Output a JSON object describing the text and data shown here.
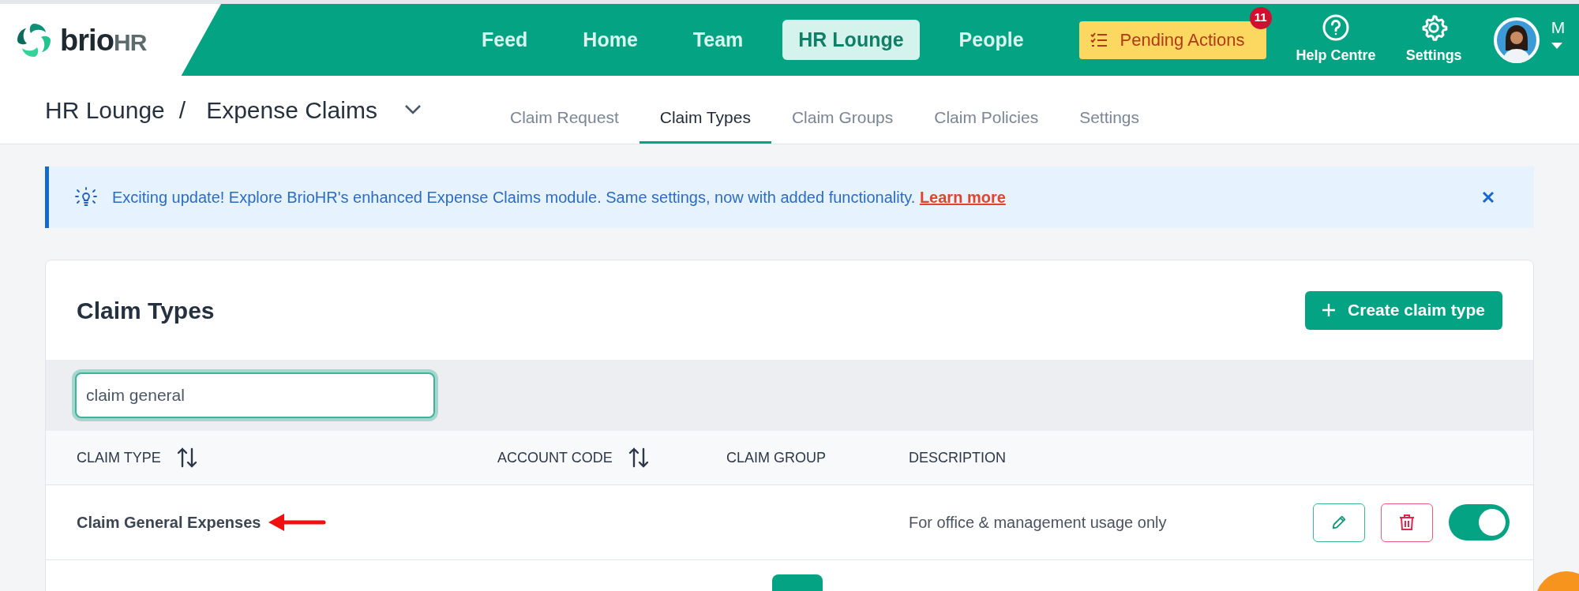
{
  "logo": {
    "primary": "brio",
    "secondary": "HR"
  },
  "nav": [
    {
      "label": "Feed",
      "selected": false
    },
    {
      "label": "Home",
      "selected": false
    },
    {
      "label": "Team",
      "selected": false
    },
    {
      "label": "HR Lounge",
      "selected": true
    },
    {
      "label": "People",
      "selected": false
    }
  ],
  "pending_actions": {
    "label": "Pending Actions",
    "badge": "11"
  },
  "utilities": [
    {
      "kind": "help",
      "label": "Help Centre"
    },
    {
      "kind": "settings",
      "label": "Settings"
    }
  ],
  "user": {
    "initial": "M"
  },
  "breadcrumb": [
    "HR Lounge",
    "/",
    "Expense Claims"
  ],
  "tabs": [
    {
      "label": "Claim Request",
      "selected": false
    },
    {
      "label": "Claim Types",
      "selected": true
    },
    {
      "label": "Claim Groups",
      "selected": false
    },
    {
      "label": "Claim Policies",
      "selected": false
    },
    {
      "label": "Settings",
      "selected": false
    }
  ],
  "banner": {
    "text": "Exciting update! Explore BrioHR's enhanced Expense Claims module. Same settings, now with added functionality.",
    "link": "Learn more"
  },
  "card": {
    "title": "Claim Types",
    "create_button": "Create claim type"
  },
  "search": {
    "value": "claim general"
  },
  "table": {
    "columns": [
      {
        "label": "CLAIM TYPE",
        "kind": "sortable"
      },
      {
        "label": "ACCOUNT CODE",
        "kind": "sortable"
      },
      {
        "label": "CLAIM GROUP",
        "kind": "plain"
      },
      {
        "label": "DESCRIPTION",
        "kind": "plain"
      }
    ],
    "rows": [
      {
        "claim_type": "Claim General Expenses",
        "description": "For office & management usage only",
        "on": true
      }
    ]
  }
}
